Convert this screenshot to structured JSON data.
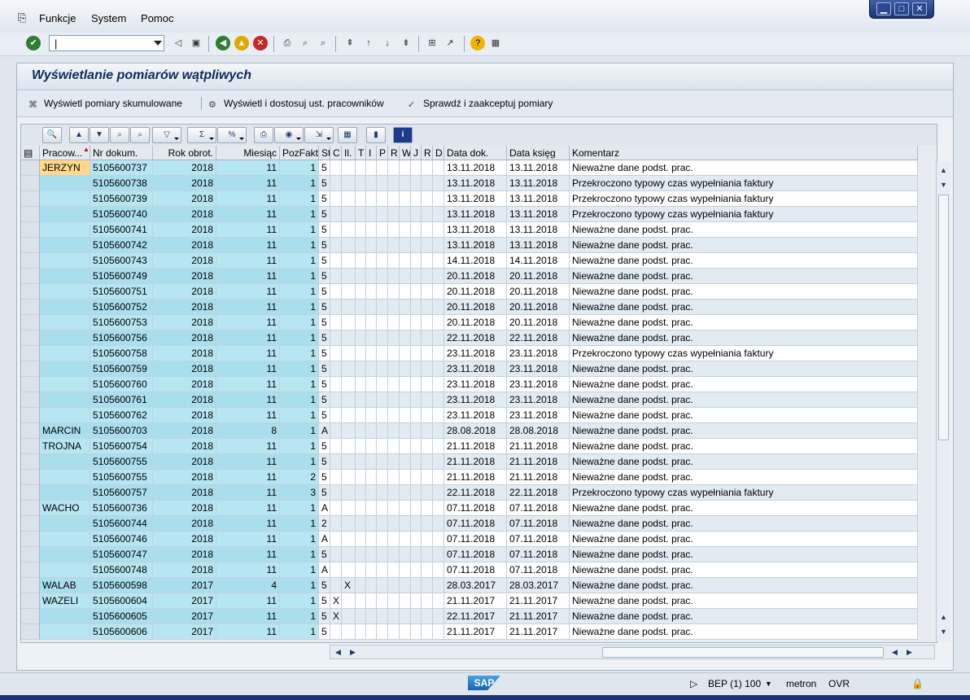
{
  "menu": {
    "items": [
      "Funkcje",
      "System",
      "Pomoc"
    ]
  },
  "title": "Wyświetlanie pomiarów wątpliwych",
  "app_toolbar": {
    "btn1": "Wyświetl pomiary skumulowane",
    "btn2": "Wyświetl i dostosuj ust. pracowników",
    "btn3": "Sprawdź i zaakceptuj pomiary"
  },
  "columns": [
    "Pracow...",
    "Nr dokum.",
    "Rok obrot.",
    "Miesiąc",
    "PozFakt",
    "St",
    "C",
    "Il.",
    "T",
    "I",
    "P",
    "R",
    "W",
    "J",
    "R",
    "D",
    "Data dok.",
    "Data księg",
    "Komentarz"
  ],
  "rows": [
    {
      "p": "JERZYN",
      "n": "5105600737",
      "y": "2018",
      "m": "11",
      "pf": "1",
      "st": "5",
      "c": "",
      "il": "",
      "dd": "13.11.2018",
      "dk": "13.11.2018",
      "k": "Nieważne dane podst. prac."
    },
    {
      "p": "",
      "n": "5105600738",
      "y": "2018",
      "m": "11",
      "pf": "1",
      "st": "5",
      "c": "",
      "il": "",
      "dd": "13.11.2018",
      "dk": "13.11.2018",
      "k": "Przekroczono typowy czas wypełniania faktury"
    },
    {
      "p": "",
      "n": "5105600739",
      "y": "2018",
      "m": "11",
      "pf": "1",
      "st": "5",
      "c": "",
      "il": "",
      "dd": "13.11.2018",
      "dk": "13.11.2018",
      "k": "Przekroczono typowy czas wypełniania faktury"
    },
    {
      "p": "",
      "n": "5105600740",
      "y": "2018",
      "m": "11",
      "pf": "1",
      "st": "5",
      "c": "",
      "il": "",
      "dd": "13.11.2018",
      "dk": "13.11.2018",
      "k": "Przekroczono typowy czas wypełniania faktury"
    },
    {
      "p": "",
      "n": "5105600741",
      "y": "2018",
      "m": "11",
      "pf": "1",
      "st": "5",
      "c": "",
      "il": "",
      "dd": "13.11.2018",
      "dk": "13.11.2018",
      "k": "Nieważne dane podst. prac."
    },
    {
      "p": "",
      "n": "5105600742",
      "y": "2018",
      "m": "11",
      "pf": "1",
      "st": "5",
      "c": "",
      "il": "",
      "dd": "13.11.2018",
      "dk": "13.11.2018",
      "k": "Nieważne dane podst. prac."
    },
    {
      "p": "",
      "n": "5105600743",
      "y": "2018",
      "m": "11",
      "pf": "1",
      "st": "5",
      "c": "",
      "il": "",
      "dd": "14.11.2018",
      "dk": "14.11.2018",
      "k": "Nieważne dane podst. prac."
    },
    {
      "p": "",
      "n": "5105600749",
      "y": "2018",
      "m": "11",
      "pf": "1",
      "st": "5",
      "c": "",
      "il": "",
      "dd": "20.11.2018",
      "dk": "20.11.2018",
      "k": "Nieważne dane podst. prac."
    },
    {
      "p": "",
      "n": "5105600751",
      "y": "2018",
      "m": "11",
      "pf": "1",
      "st": "5",
      "c": "",
      "il": "",
      "dd": "20.11.2018",
      "dk": "20.11.2018",
      "k": "Nieważne dane podst. prac."
    },
    {
      "p": "",
      "n": "5105600752",
      "y": "2018",
      "m": "11",
      "pf": "1",
      "st": "5",
      "c": "",
      "il": "",
      "dd": "20.11.2018",
      "dk": "20.11.2018",
      "k": "Nieważne dane podst. prac."
    },
    {
      "p": "",
      "n": "5105600753",
      "y": "2018",
      "m": "11",
      "pf": "1",
      "st": "5",
      "c": "",
      "il": "",
      "dd": "20.11.2018",
      "dk": "20.11.2018",
      "k": "Nieważne dane podst. prac."
    },
    {
      "p": "",
      "n": "5105600756",
      "y": "2018",
      "m": "11",
      "pf": "1",
      "st": "5",
      "c": "",
      "il": "",
      "dd": "22.11.2018",
      "dk": "22.11.2018",
      "k": "Nieważne dane podst. prac."
    },
    {
      "p": "",
      "n": "5105600758",
      "y": "2018",
      "m": "11",
      "pf": "1",
      "st": "5",
      "c": "",
      "il": "",
      "dd": "23.11.2018",
      "dk": "23.11.2018",
      "k": "Przekroczono typowy czas wypełniania faktury"
    },
    {
      "p": "",
      "n": "5105600759",
      "y": "2018",
      "m": "11",
      "pf": "1",
      "st": "5",
      "c": "",
      "il": "",
      "dd": "23.11.2018",
      "dk": "23.11.2018",
      "k": "Nieważne dane podst. prac."
    },
    {
      "p": "",
      "n": "5105600760",
      "y": "2018",
      "m": "11",
      "pf": "1",
      "st": "5",
      "c": "",
      "il": "",
      "dd": "23.11.2018",
      "dk": "23.11.2018",
      "k": "Nieważne dane podst. prac."
    },
    {
      "p": "",
      "n": "5105600761",
      "y": "2018",
      "m": "11",
      "pf": "1",
      "st": "5",
      "c": "",
      "il": "",
      "dd": "23.11.2018",
      "dk": "23.11.2018",
      "k": "Nieważne dane podst. prac."
    },
    {
      "p": "",
      "n": "5105600762",
      "y": "2018",
      "m": "11",
      "pf": "1",
      "st": "5",
      "c": "",
      "il": "",
      "dd": "23.11.2018",
      "dk": "23.11.2018",
      "k": "Nieważne dane podst. prac."
    },
    {
      "p": "MARCIN",
      "n": "5105600703",
      "y": "2018",
      "m": "8",
      "pf": "1",
      "st": "A",
      "c": "",
      "il": "",
      "dd": "28.08.2018",
      "dk": "28.08.2018",
      "k": "Nieważne dane podst. prac."
    },
    {
      "p": "TROJNA",
      "n": "5105600754",
      "y": "2018",
      "m": "11",
      "pf": "1",
      "st": "5",
      "c": "",
      "il": "",
      "dd": "21.11.2018",
      "dk": "21.11.2018",
      "k": "Nieważne dane podst. prac."
    },
    {
      "p": "",
      "n": "5105600755",
      "y": "2018",
      "m": "11",
      "pf": "1",
      "st": "5",
      "c": "",
      "il": "",
      "dd": "21.11.2018",
      "dk": "21.11.2018",
      "k": "Nieważne dane podst. prac."
    },
    {
      "p": "",
      "n": "5105600755",
      "y": "2018",
      "m": "11",
      "pf": "2",
      "st": "5",
      "c": "",
      "il": "",
      "dd": "21.11.2018",
      "dk": "21.11.2018",
      "k": "Nieważne dane podst. prac."
    },
    {
      "p": "",
      "n": "5105600757",
      "y": "2018",
      "m": "11",
      "pf": "3",
      "st": "5",
      "c": "",
      "il": "",
      "dd": "22.11.2018",
      "dk": "22.11.2018",
      "k": "Przekroczono typowy czas wypełniania faktury"
    },
    {
      "p": "WACHO",
      "n": "5105600736",
      "y": "2018",
      "m": "11",
      "pf": "1",
      "st": "A",
      "c": "",
      "il": "",
      "dd": "07.11.2018",
      "dk": "07.11.2018",
      "k": "Nieważne dane podst. prac."
    },
    {
      "p": "",
      "n": "5105600744",
      "y": "2018",
      "m": "11",
      "pf": "1",
      "st": "2",
      "c": "",
      "il": "",
      "dd": "07.11.2018",
      "dk": "07.11.2018",
      "k": "Nieważne dane podst. prac."
    },
    {
      "p": "",
      "n": "5105600746",
      "y": "2018",
      "m": "11",
      "pf": "1",
      "st": "A",
      "c": "",
      "il": "",
      "dd": "07.11.2018",
      "dk": "07.11.2018",
      "k": "Nieważne dane podst. prac."
    },
    {
      "p": "",
      "n": "5105600747",
      "y": "2018",
      "m": "11",
      "pf": "1",
      "st": "5",
      "c": "",
      "il": "",
      "dd": "07.11.2018",
      "dk": "07.11.2018",
      "k": "Nieważne dane podst. prac."
    },
    {
      "p": "",
      "n": "5105600748",
      "y": "2018",
      "m": "11",
      "pf": "1",
      "st": "A",
      "c": "",
      "il": "",
      "dd": "07.11.2018",
      "dk": "07.11.2018",
      "k": "Nieważne dane podst. prac."
    },
    {
      "p": "WALAB",
      "n": "5105600598",
      "y": "2017",
      "m": "4",
      "pf": "1",
      "st": "5",
      "c": "",
      "il": "X",
      "dd": "28.03.2017",
      "dk": "28.03.2017",
      "k": "Nieważne dane podst. prac."
    },
    {
      "p": "WAZELI",
      "n": "5105600604",
      "y": "2017",
      "m": "11",
      "pf": "1",
      "st": "5",
      "c": "X",
      "il": "",
      "dd": "21.11.2017",
      "dk": "21.11.2017",
      "k": "Nieważne dane podst. prac."
    },
    {
      "p": "",
      "n": "5105600605",
      "y": "2017",
      "m": "11",
      "pf": "1",
      "st": "5",
      "c": "X",
      "il": "",
      "dd": "22.11.2017",
      "dk": "21.11.2017",
      "k": "Nieważne dane podst. prac."
    },
    {
      "p": "",
      "n": "5105600606",
      "y": "2017",
      "m": "11",
      "pf": "1",
      "st": "5",
      "c": "",
      "il": "",
      "dd": "21.11.2017",
      "dk": "21.11.2017",
      "k": "Nieważne dane podst. prac."
    }
  ],
  "status": {
    "system": "BEP (1) 100",
    "user": "metron",
    "mode": "OVR",
    "logo": "SAP"
  },
  "colors": {
    "key_column": "#b5e6f2",
    "header_text": "#0c2a58",
    "selected_cell": "#ffd88a"
  }
}
